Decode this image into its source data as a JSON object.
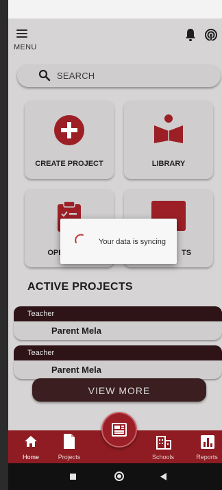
{
  "header": {
    "menu_label": "MENU"
  },
  "search": {
    "placeholder": "SEARCH"
  },
  "cards": [
    {
      "label": "CREATE PROJECT",
      "icon": "plus-circle-icon"
    },
    {
      "label": "LIBRARY",
      "icon": "reader-book-icon"
    },
    {
      "label": "OPE",
      "icon": "clipboard-icon"
    },
    {
      "label": "TS",
      "icon": "bar-chart-icon"
    }
  ],
  "active_projects": {
    "title": "ACTIVE PROJECTS",
    "items": [
      {
        "role": "Teacher",
        "name": "Parent Mela"
      },
      {
        "role": "Teacher",
        "name": "Parent Mela"
      }
    ],
    "view_more": "VIEW MORE"
  },
  "bottom_nav": [
    {
      "label": "Home",
      "icon": "home-icon",
      "active": true
    },
    {
      "label": "Projects",
      "icon": "file-icon",
      "active": false
    },
    {
      "label": "Schools",
      "icon": "building-icon",
      "active": false
    },
    {
      "label": "Reports",
      "icon": "bar-chart-icon",
      "active": false
    }
  ],
  "dialog": {
    "message": "Your data is syncing"
  },
  "colors": {
    "brand": "#8f1c22",
    "dark": "#2f1417",
    "background": "#d6d4d5",
    "card": "#cfcdce"
  }
}
